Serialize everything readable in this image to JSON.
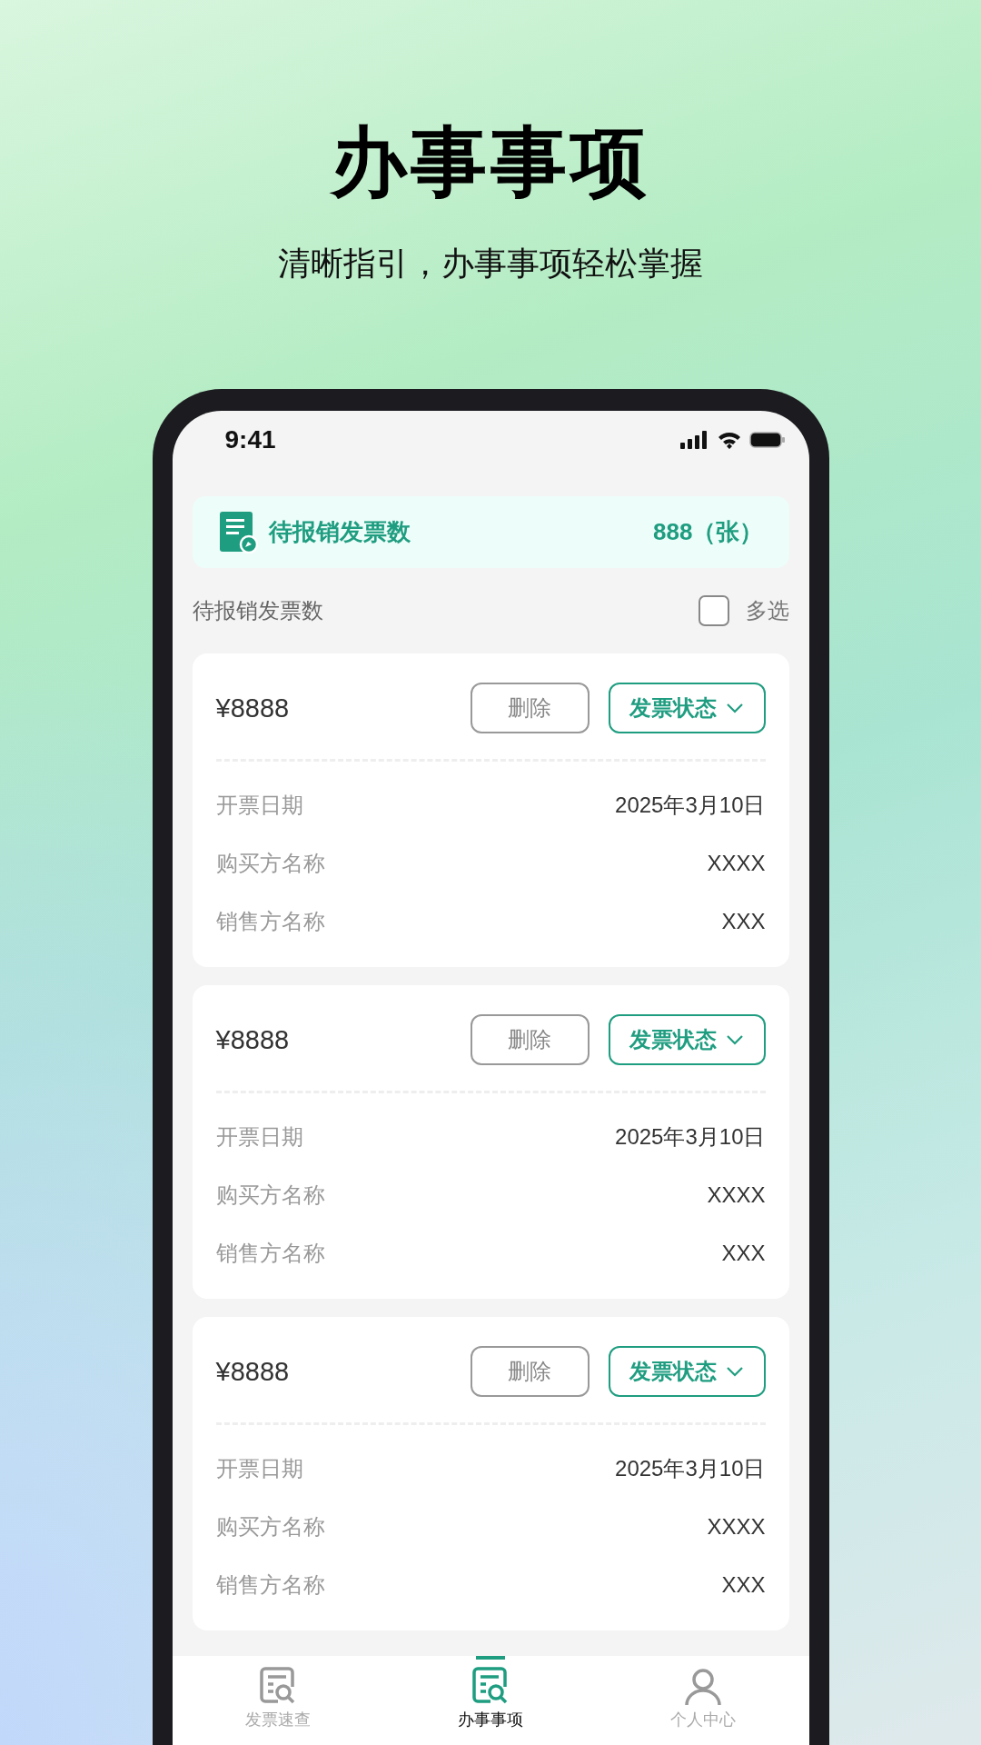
{
  "headline": "办事事项",
  "subtitle": "清晰指引，办事事项轻松掌握",
  "status_bar": {
    "time": "9:41"
  },
  "summary": {
    "label": "待报销发票数",
    "count": "888（张）"
  },
  "list_header": {
    "title": "待报销发票数",
    "multi_select": {
      "label": "多选",
      "checked": false
    }
  },
  "invoices": [
    {
      "amount": "¥8888",
      "delete_label": "删除",
      "status_label": "发票状态",
      "fields": [
        {
          "label": "开票日期",
          "value": "2025年3月10日"
        },
        {
          "label": "购买方名称",
          "value": "XXXX"
        },
        {
          "label": "销售方名称",
          "value": "XXX"
        }
      ]
    },
    {
      "amount": "¥8888",
      "delete_label": "删除",
      "status_label": "发票状态",
      "fields": [
        {
          "label": "开票日期",
          "value": "2025年3月10日"
        },
        {
          "label": "购买方名称",
          "value": "XXXX"
        },
        {
          "label": "销售方名称",
          "value": "XXX"
        }
      ]
    },
    {
      "amount": "¥8888",
      "delete_label": "删除",
      "status_label": "发票状态",
      "fields": [
        {
          "label": "开票日期",
          "value": "2025年3月10日"
        },
        {
          "label": "购买方名称",
          "value": "XXXX"
        },
        {
          "label": "销售方名称",
          "value": "XXX"
        }
      ]
    }
  ],
  "tabs": [
    {
      "label": "发票速查",
      "selected": false,
      "kind": "document"
    },
    {
      "label": "办事事项",
      "selected": true,
      "kind": "document"
    },
    {
      "label": "个人中心",
      "selected": false,
      "kind": "person"
    }
  ]
}
